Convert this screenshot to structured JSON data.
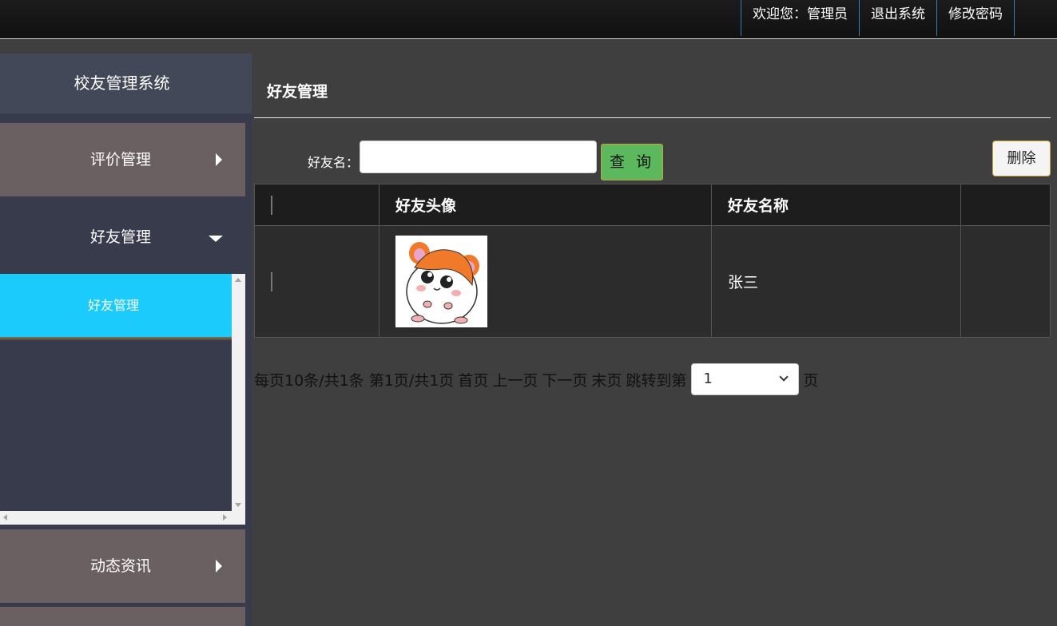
{
  "header": {
    "welcome": "欢迎您：管理员",
    "logout": "退出系统",
    "change_password": "修改密码"
  },
  "sidebar": {
    "title": "校友管理系统",
    "menus": [
      {
        "label": "评价管理",
        "expanded": false
      },
      {
        "label": "好友管理",
        "expanded": true,
        "items": [
          {
            "label": "好友管理",
            "active": true
          }
        ]
      },
      {
        "label": "动态资讯",
        "expanded": false
      }
    ]
  },
  "main": {
    "title": "好友管理",
    "search": {
      "label": "好友名：",
      "value": "",
      "button": "查 询"
    },
    "delete_button": "删除",
    "table": {
      "headers": [
        "",
        "好友头像",
        "好友名称",
        ""
      ],
      "rows": [
        {
          "checked": false,
          "avatar": "hamster-avatar-image",
          "name": "张三"
        }
      ]
    },
    "pagination": {
      "summary": "每页10条/共1条 第1页/共1页",
      "first": "首页",
      "prev": "上一页",
      "next": "下一页",
      "last": "末页",
      "jump_label": "跳转到第",
      "selected_page": "1",
      "page_suffix": "页"
    }
  },
  "colors": {
    "active_submenu": "#1acbfb",
    "query_button": "#5cb85c",
    "menu_collapsed": "#6a6062"
  }
}
